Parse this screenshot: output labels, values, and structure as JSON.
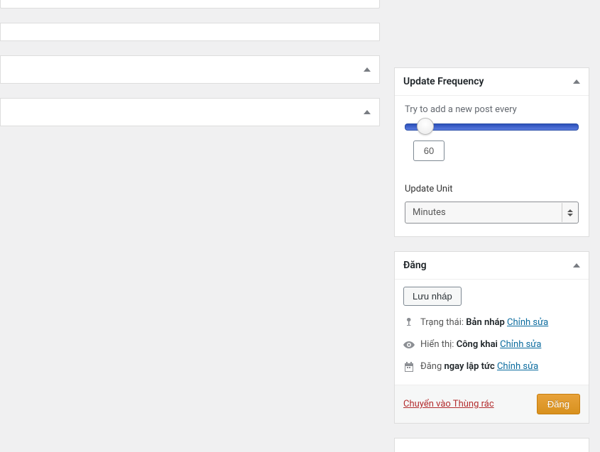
{
  "update_frequency": {
    "title": "Update Frequency",
    "hint": "Try to add a new post every",
    "slider_value": "60",
    "unit_label": "Update Unit",
    "unit_selected": "Minutes"
  },
  "publish": {
    "title": "Đăng",
    "save_draft_label": "Lưu nháp",
    "status_label": "Trạng thái:",
    "status_value": "Bản nháp",
    "visibility_label": "Hiển thị:",
    "visibility_value": "Công khai",
    "schedule_label": "Đăng",
    "schedule_value": "ngay lập tức",
    "edit_label": "Chỉnh sửa",
    "trash_label": "Chuyển vào Thùng rác",
    "publish_button_label": "Đăng"
  }
}
